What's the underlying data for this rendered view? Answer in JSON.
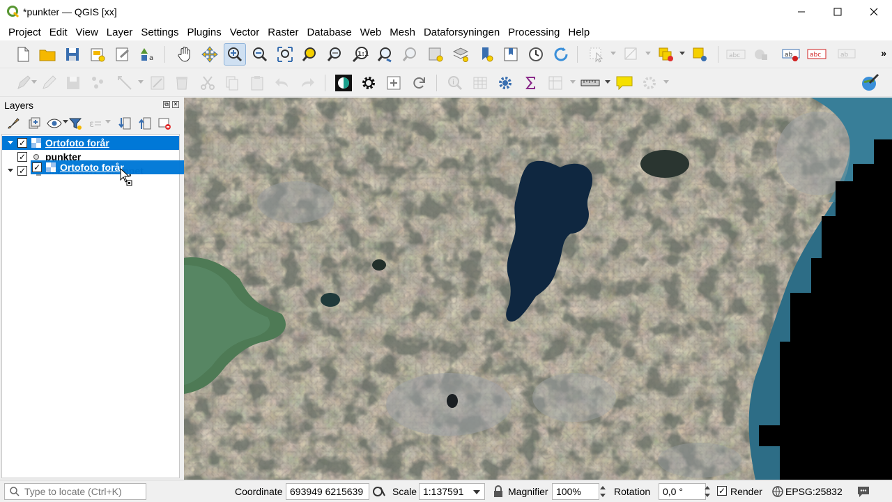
{
  "window": {
    "title": "*punkter — QGIS [xx]",
    "controls": {
      "minimize": "—",
      "maximize": "☐",
      "close": "✕"
    }
  },
  "menu": [
    "Project",
    "Edit",
    "View",
    "Layer",
    "Settings",
    "Plugins",
    "Vector",
    "Raster",
    "Database",
    "Web",
    "Mesh",
    "Dataforsyningen",
    "Processing",
    "Help"
  ],
  "toolbar": {
    "overflow": "»",
    "icons_row1": [
      "new-project",
      "open-project",
      "save-project",
      "new-print-layout",
      "layout-manager",
      "style-manager",
      "pan",
      "pan-to-selection",
      "zoom-in",
      "zoom-out",
      "zoom-full",
      "zoom-to-selection",
      "zoom-to-layer",
      "zoom-native",
      "zoom-last",
      "zoom-next",
      "new-bookmark",
      "show-bookmarks",
      "temporal-controller",
      "refresh",
      "select-features",
      "deselect",
      "identify",
      "measure",
      "label-toolbar"
    ],
    "label_tool_text": "abc"
  },
  "layers_panel": {
    "title": "Layers",
    "items": [
      {
        "label": "Ortofoto forår",
        "checked": true,
        "selected": true,
        "type": "raster"
      },
      {
        "label": "punkter",
        "checked": true,
        "selected": false,
        "type": "point"
      },
      {
        "label": "Skærmkort - dæmpet",
        "checked": true,
        "selected": false,
        "type": "raster"
      }
    ],
    "drag_item": {
      "label": "Ortofoto forår",
      "checked": true
    }
  },
  "statusbar": {
    "locate_placeholder": "Type to locate (Ctrl+K)",
    "coordinate_label": "Coordinate",
    "coordinate_value": "693949 6215639",
    "scale_label": "Scale",
    "scale_value": "1:137591",
    "magnifier_label": "Magnifier",
    "magnifier_value": "100%",
    "rotation_label": "Rotation",
    "rotation_value": "0,0 °",
    "render_label": "Render",
    "render_checked": true,
    "crs": "EPSG:25832"
  },
  "colors": {
    "selection": "#0078d7",
    "qgis_green": "#589632",
    "water_dark": "#0f2740",
    "sea": "#2d6d86"
  }
}
